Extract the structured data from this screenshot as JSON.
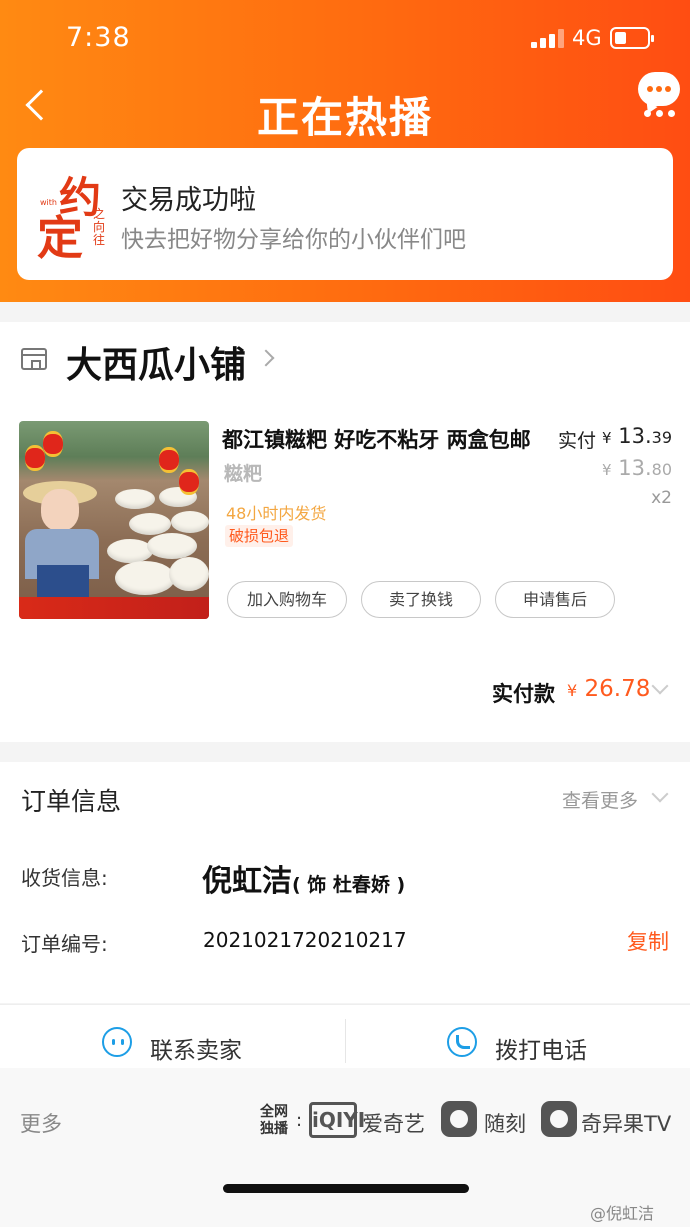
{
  "status_bar": {
    "time": "7:38",
    "network": "4G"
  },
  "nav": {
    "title": "正在热播"
  },
  "success": {
    "logo_main_1": "约",
    "logo_main_2": "定",
    "logo_side": "之向往",
    "logo_tiny": "with",
    "heading": "交易成功啦",
    "subtext": "快去把好物分享给你的小伙伴们吧"
  },
  "shop": {
    "name": "大西瓜小铺",
    "product": {
      "name": "都江镇糍粑 好吃不粘牙 两盒包邮",
      "paid_label": "实付",
      "currency": "¥",
      "paid_int": "13.",
      "paid_dec": "39",
      "sku": "糍粑",
      "orig_int": "13.",
      "orig_dec": "80",
      "qty": "x2",
      "ship_note": "48小时内发货",
      "refund_tag": "破损包退"
    },
    "buttons": {
      "add_cart": "加入购物车",
      "resell": "卖了换钱",
      "after_sale": "申请售后"
    },
    "total_label": "实付款",
    "total_value": "26.78"
  },
  "order": {
    "heading": "订单信息",
    "more": "查看更多",
    "receiver_label": "收货信息:",
    "receiver_name": "倪虹洁",
    "receiver_note": "( 饰 杜春娇 )",
    "order_no_label": "订单编号:",
    "order_no": "2021021720210217",
    "copy": "复制"
  },
  "actions": {
    "contact": "联系卖家",
    "call": "拨打电话"
  },
  "footer": {
    "more": "更多",
    "exclusive": "全网独播",
    "colon": ":",
    "iqiyi_logo": "iQIYI",
    "iqiyi_name": "爱奇艺",
    "suike": "随刻",
    "qiyiguo": "奇异果TV",
    "watermark": "@倪虹洁"
  }
}
